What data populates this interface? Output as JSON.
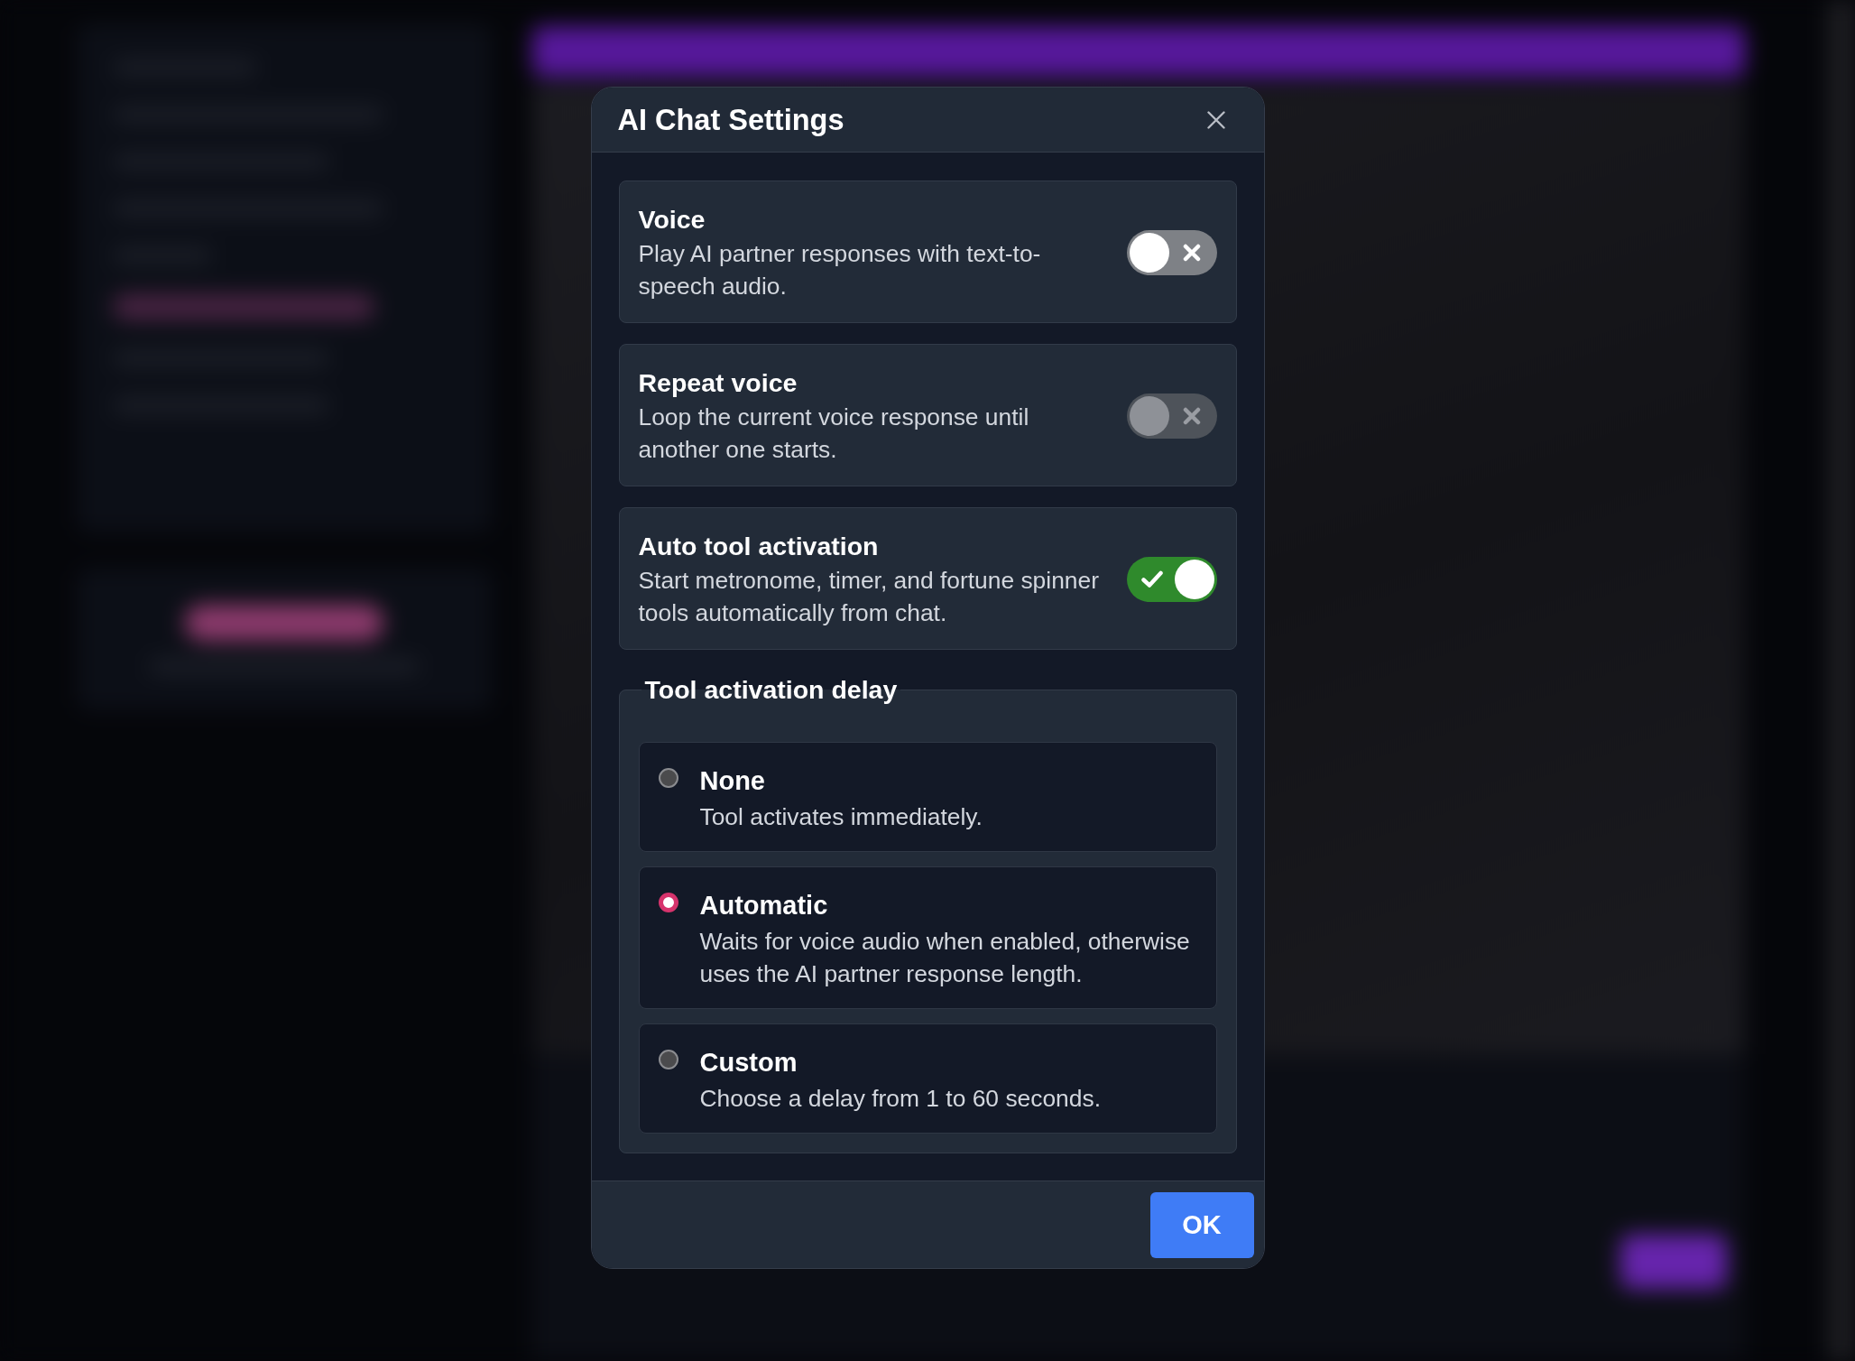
{
  "dialog": {
    "title": "AI Chat Settings",
    "settings": [
      {
        "title": "Voice",
        "description": "Play AI partner responses with text-to-speech audio.",
        "on": false,
        "disabled": false
      },
      {
        "title": "Repeat voice",
        "description": "Loop the current voice response until another one starts.",
        "on": false,
        "disabled": true
      },
      {
        "title": "Auto tool activation",
        "description": "Start metronome, timer, and fortune spinner tools automatically from chat.",
        "on": true,
        "disabled": false
      }
    ],
    "delay": {
      "legend": "Tool activation delay",
      "options": [
        {
          "title": "None",
          "description": "Tool activates immediately.",
          "selected": false
        },
        {
          "title": "Automatic",
          "description": "Waits for voice audio when enabled, otherwise uses the AI partner response length.",
          "selected": true
        },
        {
          "title": "Custom",
          "description": "Choose a delay from 1 to 60 seconds.",
          "selected": false
        }
      ]
    },
    "buttons": [
      {
        "label": "OK"
      }
    ]
  }
}
